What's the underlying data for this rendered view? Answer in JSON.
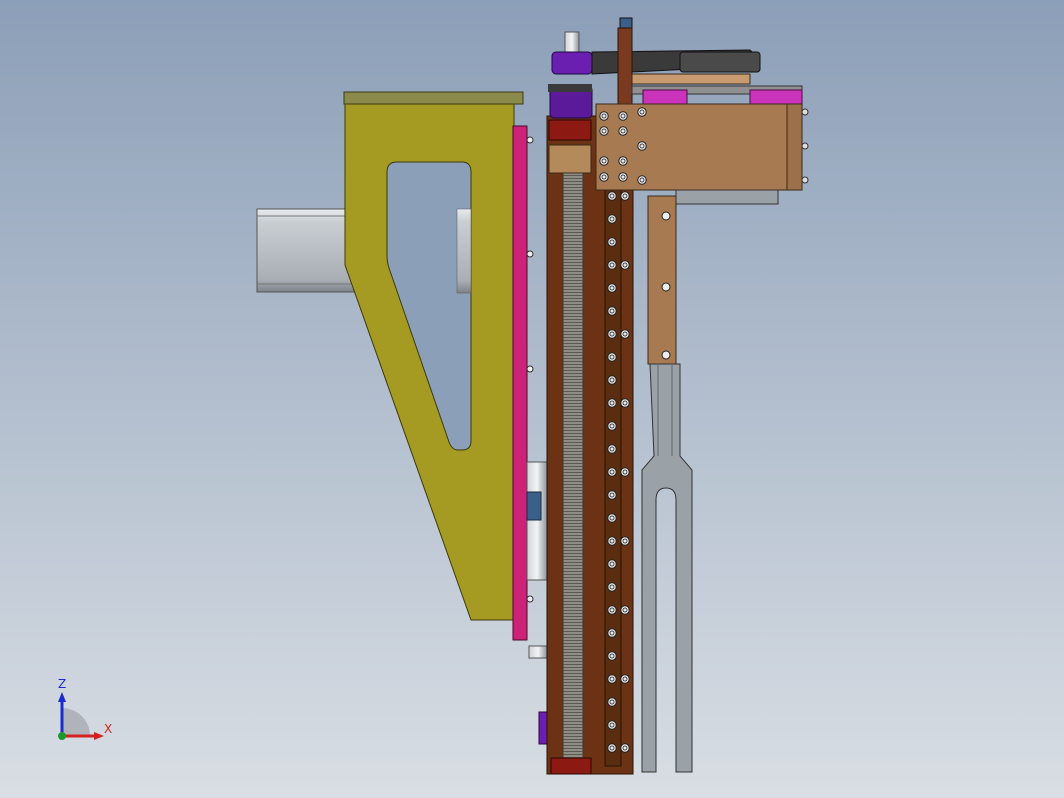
{
  "viewport": {
    "background_top": "#8c9fb8",
    "background_bottom": "#d9dee4"
  },
  "triad": {
    "z_label": "Z",
    "x_label": "X",
    "colors": {
      "z": "#1a2bd6",
      "x": "#d42020",
      "y": "#1a9a2a"
    }
  },
  "colors": {
    "bracket": "#a59a22",
    "magenta": "#cc2277",
    "brown_column": "#6b3313",
    "wood": "#a87a52",
    "steel": "#9aa1a7",
    "belt": "#3a3a3a",
    "purple": "#6a1fb0",
    "dark_red": "#7a1010",
    "pink": "#cc33bb"
  }
}
